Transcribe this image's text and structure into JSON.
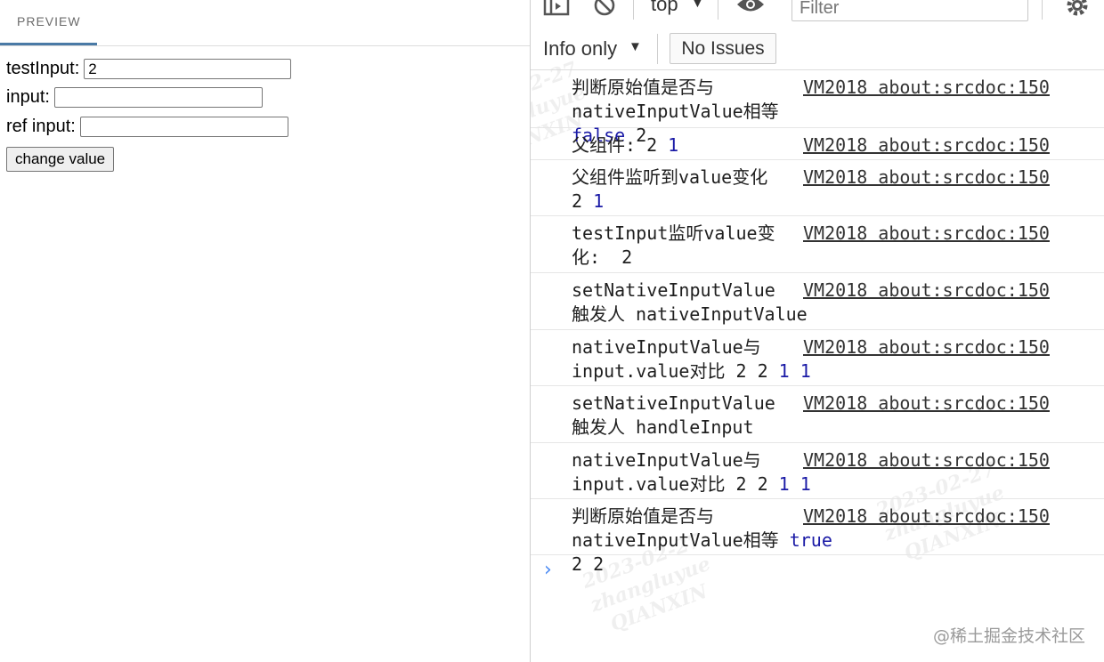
{
  "preview": {
    "tab_label": "PREVIEW",
    "test_input_label": "testInput:",
    "test_input_value": "2",
    "input_label": "input:",
    "input_value": "",
    "ref_input_label": "ref input:",
    "ref_input_value": "",
    "change_button": "change value"
  },
  "console": {
    "context": "top",
    "filter_placeholder": "Filter",
    "level": "Info only",
    "issues": "No Issues",
    "prompt": "›",
    "messages": [
      {
        "line1": "判断原始值是否与",
        "line2_text": "nativeInputValue相等 ",
        "line2_kw": "false",
        "line2_rest": " 2",
        "source": "VM2018 about:srcdoc:150"
      },
      {
        "line1_text": "父组件: 2 ",
        "line1_num": "1",
        "source": "VM2018 about:srcdoc:150"
      },
      {
        "line1": "父组件监听到value变化",
        "line2_text": "2 ",
        "line2_num": "1",
        "source": "VM2018 about:srcdoc:150"
      },
      {
        "line1": "testInput监听value变",
        "line2": "化:  2",
        "source": "VM2018 about:srcdoc:150"
      },
      {
        "line1": "setNativeInputValue",
        "line2": "触发人 nativeInputValue",
        "source": "VM2018 about:srcdoc:150"
      },
      {
        "line1": "nativeInputValue与",
        "line2_text": "input.value对比 2 2 ",
        "line2_num": "1 1",
        "source": "VM2018 about:srcdoc:150"
      },
      {
        "line1": "setNativeInputValue",
        "line2": "触发人 handleInput",
        "source": "VM2018 about:srcdoc:150"
      },
      {
        "line1": "nativeInputValue与",
        "line2_text": "input.value对比 2 2 ",
        "line2_num": "1 1",
        "source": "VM2018 about:srcdoc:150"
      },
      {
        "line1": "判断原始值是否与",
        "line2_text": "nativeInputValue相等 ",
        "line2_kw": "true",
        "line2_rest": " 2 2",
        "source": "VM2018 about:srcdoc:150"
      }
    ]
  },
  "watermark": {
    "date": "2023-02-27",
    "user": "zhangluyue",
    "org": "QIANXIN"
  },
  "credit": "@稀土掘金技术社区",
  "colors": {
    "tab_underline": "#4a7aa6",
    "number": "#1a1aa6",
    "prompt": "#4a8af4"
  }
}
